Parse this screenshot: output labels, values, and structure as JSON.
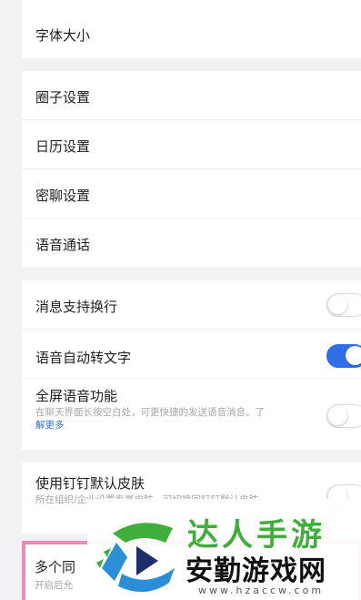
{
  "sections": {
    "top": {
      "font_size": "字体大小"
    },
    "general": {
      "items": [
        "圈子设置",
        "日历设置",
        "密聊设置",
        "语音通话"
      ]
    },
    "toggles": {
      "msg_wrap": {
        "label": "消息支持换行",
        "on": false
      },
      "voice_to_text": {
        "label": "语音自动转文字",
        "on": true
      },
      "fullscreen_voice": {
        "label": "全屏语音功能",
        "desc": "在聊天界面长按空白处，可更快捷的发送语音消息。了",
        "link": "解更多",
        "on": false
      }
    },
    "skin": {
      "label": "使用钉钉默认皮肤",
      "desc": "所在组织/企业设置专属皮肤，可切换回钉钉默认皮肤",
      "on": false
    },
    "partial": {
      "label": "多个同",
      "desc": "开启后允"
    }
  },
  "watermark": {
    "top_text": "达人手游",
    "main_text": "安勤游戏网",
    "url": "www.hzaccw.com"
  },
  "colors": {
    "accent": "#2f6ee8",
    "link": "#3b6fe0",
    "watermark_green": "#3fae3a"
  }
}
